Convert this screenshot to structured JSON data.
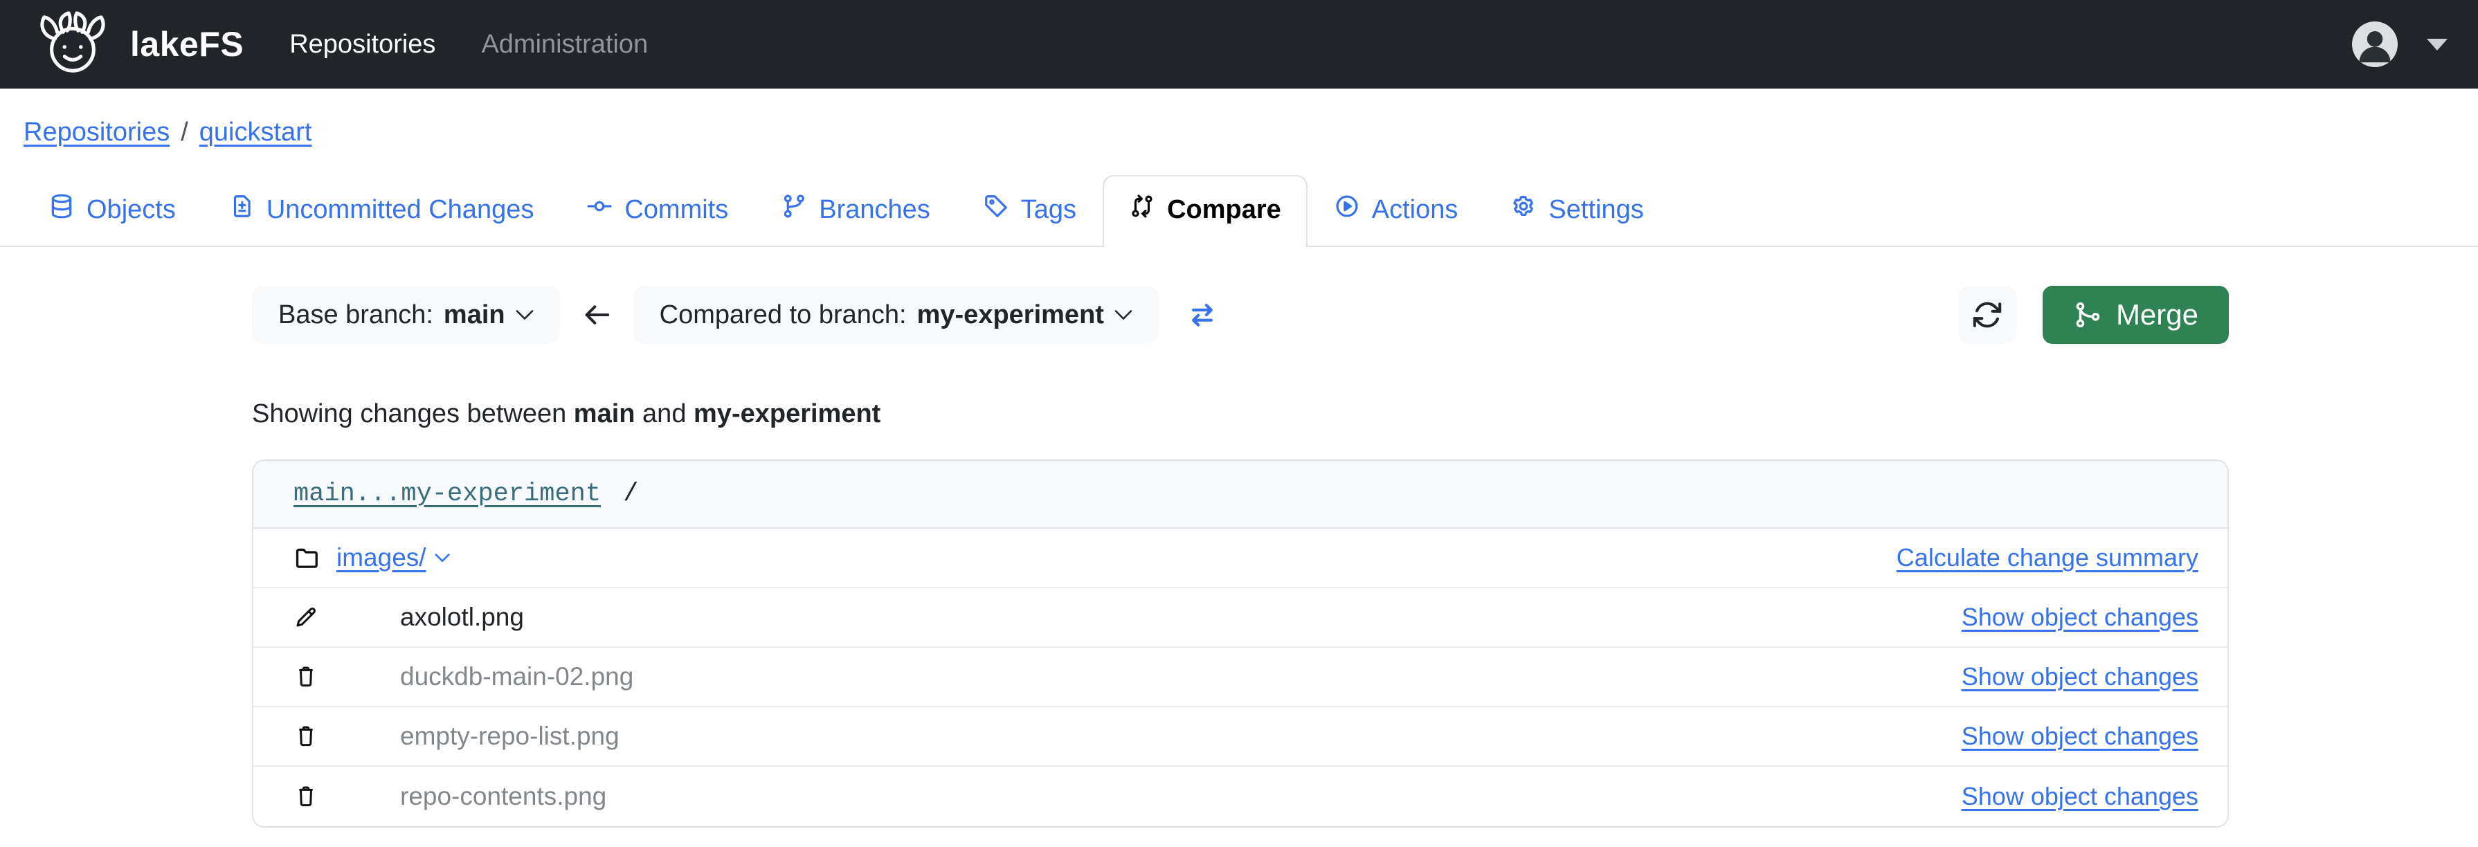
{
  "navbar": {
    "brand": "lakeFS",
    "logo_icon": "axolotl-logo",
    "items": [
      {
        "label": "Repositories",
        "state": "active"
      },
      {
        "label": "Administration",
        "state": "muted"
      }
    ],
    "user_icon": "user-avatar-icon",
    "caret_icon": "caret-down-icon"
  },
  "breadcrumb": {
    "items": [
      "Repositories",
      "quickstart"
    ],
    "separator": "/"
  },
  "tabs": [
    {
      "label": "Objects",
      "icon": "database-icon",
      "active": false
    },
    {
      "label": "Uncommitted Changes",
      "icon": "file-diff-icon",
      "active": false
    },
    {
      "label": "Commits",
      "icon": "commit-icon",
      "active": false
    },
    {
      "label": "Branches",
      "icon": "branch-icon",
      "active": false
    },
    {
      "label": "Tags",
      "icon": "tag-icon",
      "active": false
    },
    {
      "label": "Compare",
      "icon": "compare-icon",
      "active": true
    },
    {
      "label": "Actions",
      "icon": "play-circle-icon",
      "active": false
    },
    {
      "label": "Settings",
      "icon": "gear-icon",
      "active": false
    }
  ],
  "controls": {
    "base_label": "Base branch:",
    "base_value": "main",
    "compared_label": "Compared to branch:",
    "compared_value": "my-experiment",
    "swap_icon": "swap-arrows-icon",
    "refresh_icon": "refresh-icon",
    "merge_icon": "git-merge-icon",
    "merge_label": "Merge"
  },
  "summary": {
    "prefix": "Showing changes between",
    "base": "main",
    "conjunction": "and",
    "compared": "my-experiment"
  },
  "diff_card": {
    "ref_link": "main...my-experiment",
    "path_suffix": "/",
    "folder_row": {
      "icon": "folder-icon",
      "name": "images/",
      "expander_icon": "chevron-down-icon",
      "action": "Calculate change summary"
    },
    "rows": [
      {
        "icon": "pencil-icon",
        "change": "modified",
        "name": "axolotl.png",
        "action": "Show object changes"
      },
      {
        "icon": "trash-icon",
        "change": "deleted",
        "name": "duckdb-main-02.png",
        "action": "Show object changes"
      },
      {
        "icon": "trash-icon",
        "change": "deleted",
        "name": "empty-repo-list.png",
        "action": "Show object changes"
      },
      {
        "icon": "trash-icon",
        "change": "deleted",
        "name": "repo-contents.png",
        "action": "Show object changes"
      }
    ]
  },
  "colors": {
    "navbar_bg": "#212529",
    "link_blue": "#3572ec",
    "merge_green": "#2e8254",
    "ref_teal": "#3a6d7c",
    "deleted_gray": "#82878c"
  }
}
